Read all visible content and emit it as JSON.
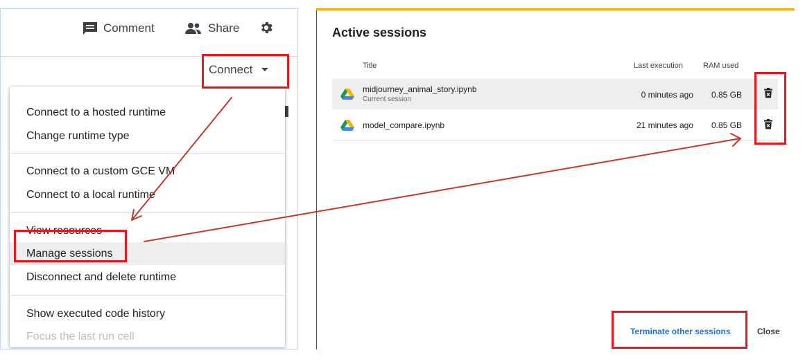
{
  "header": {
    "comment_label": "Comment",
    "share_label": "Share",
    "connect_label": "Connect"
  },
  "menu": {
    "items": [
      {
        "label": "Connect to a hosted runtime"
      },
      {
        "label": "Change runtime type"
      },
      {
        "label": "Connect to a custom GCE VM"
      },
      {
        "label": "Connect to a local runtime"
      },
      {
        "label": "View resources"
      },
      {
        "label": "Manage sessions"
      },
      {
        "label": "Disconnect and delete runtime"
      },
      {
        "label": "Show executed code history"
      },
      {
        "label": "Focus the last run cell"
      }
    ]
  },
  "dialog": {
    "title": "Active sessions",
    "columns": {
      "title": "Title",
      "last_execution": "Last execution",
      "ram_used": "RAM used"
    },
    "sessions": [
      {
        "title": "midjourney_animal_story.ipynb",
        "subtitle": "Current session",
        "last_execution": "0 minutes ago",
        "ram": "0.85 GB"
      },
      {
        "title": "model_compare.ipynb",
        "last_execution": "21 minutes ago",
        "ram": "0.85 GB"
      }
    ],
    "terminate_label": "Terminate other sessions",
    "close_label": "Close"
  },
  "colors": {
    "annotation_red": "#e5171f",
    "accent_blue": "#1a73e8",
    "top_accent": "#f9ab00",
    "drive_green": "#0f9d58",
    "drive_yellow": "#f4b400",
    "drive_blue": "#4285f4"
  },
  "icons": [
    "comment-icon",
    "share-icon",
    "gear-icon",
    "chevron-down-icon",
    "google-drive-icon",
    "delete-icon"
  ]
}
